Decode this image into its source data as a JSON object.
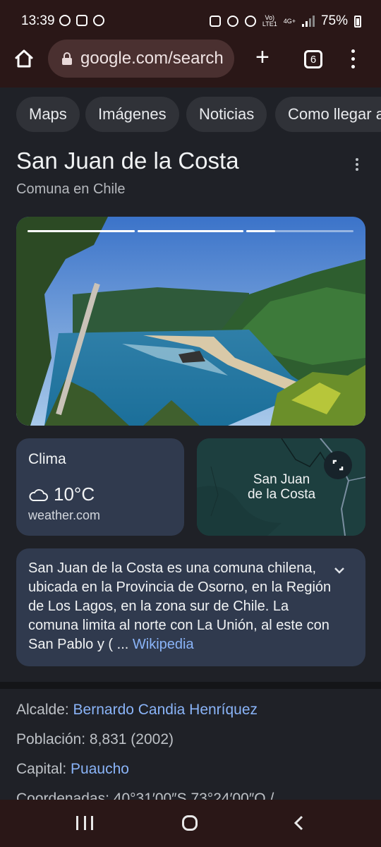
{
  "status_bar": {
    "time": "13:39",
    "network_label_1": "Vo)",
    "network_label_2": "LTE1",
    "network_type": "4G+",
    "battery": "75%"
  },
  "browser": {
    "url": "google.com/search",
    "tab_count": "6",
    "icons": [
      "home-icon",
      "lock-icon",
      "new-tab-icon",
      "tab-switcher-icon",
      "more-options-icon"
    ]
  },
  "chips": [
    "Maps",
    "Imágenes",
    "Noticias",
    "Como llegar a"
  ],
  "knowledge_panel": {
    "title": "San Juan de la Costa",
    "subtitle": "Comuna en Chile",
    "photo_progress": [
      1,
      1,
      0.27
    ],
    "weather": {
      "label": "Clima",
      "temperature": "10°C",
      "source": "weather.com",
      "icon": "cloud-icon"
    },
    "map": {
      "place_line1": "San Juan",
      "place_line2": "de la Costa",
      "icon": "expand-icon"
    },
    "description": {
      "text": "San Juan de la Costa es una comuna chilena, ubicada en la Provincia de Osorno, en la Región de Los Lagos, en la zona sur de Chile. La comuna limita al norte con La Unión, al este con San Pablo y (",
      "ellipsis": "...",
      "source_link": "Wikipedia"
    },
    "facts": [
      {
        "label": "Alcalde: ",
        "value": "Bernardo Candia Henríquez",
        "value_is_link": true
      },
      {
        "label": "Población: ",
        "value": "8,831 (2002)",
        "value_is_link": false
      },
      {
        "label": "Capital: ",
        "value": "Puaucho",
        "value_is_link": true
      },
      {
        "label": "Coordenadas: ",
        "value": "40°31′00″S 73°24′00″O /",
        "value_is_link": false
      }
    ]
  },
  "colors": {
    "system_bar": "#2a1717",
    "page_background": "#1f2127",
    "card_background": "#303a4e",
    "link": "#8ab4f8"
  }
}
